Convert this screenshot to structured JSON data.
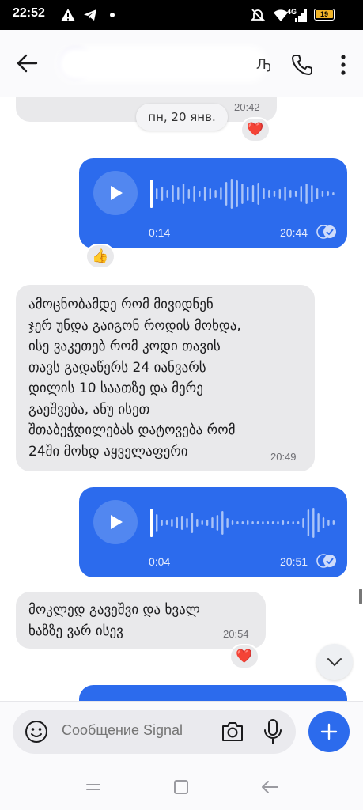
{
  "status_bar": {
    "time": "22:52",
    "battery": "19",
    "network": "4G"
  },
  "header": {
    "contact_name_visible": "Ԡ"
  },
  "chat": {
    "date_separator": "пн, 20 янв.",
    "top_message_time": "20:42",
    "top_reaction": "❤️",
    "messages": [
      {
        "type": "voice",
        "direction": "outgoing",
        "duration": "0:14",
        "time": "20:44",
        "reaction": "👍",
        "status": "delivered"
      },
      {
        "type": "text",
        "direction": "incoming",
        "text": "ამოცნობამდე რომ მივიდნენ\nჯერ უნდა გაიგონ როდის მოხდა,\nისე ვაკეთებ რომ კოდი თავის\nთავს გადაწერს 24 იანვარს\nდილის 10 საათზე და მერე\nგაეშვება, ანუ ისეთ\nშთაბეჭდილებას დატოვება რომ\n24ში მოხდ აყველაფერი",
        "time": "20:49"
      },
      {
        "type": "voice",
        "direction": "outgoing",
        "duration": "0:04",
        "time": "20:51",
        "status": "delivered"
      },
      {
        "type": "text",
        "direction": "incoming",
        "text": "მოკლედ გავეშვი და ხვალ\nხაზზე ვარ ისევ",
        "time": "20:54",
        "reaction": "❤️"
      }
    ]
  },
  "composer": {
    "placeholder": "Сообщение Signal"
  },
  "colors": {
    "outgoing_bubble": "#2c6bed",
    "incoming_bubble": "#e9e9eb",
    "accent": "#2c6bed"
  }
}
